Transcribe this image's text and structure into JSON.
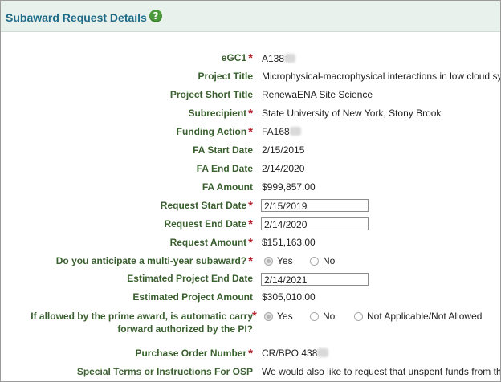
{
  "header": {
    "title": "Subaward Request Details",
    "help_icon": "?"
  },
  "fields": {
    "egc1": {
      "label": "eGC1",
      "value": "A138"
    },
    "project_title": {
      "label": "Project Title",
      "value": "Microphysical-macrophysical interactions in low cloud sy"
    },
    "project_short_title": {
      "label": "Project Short Title",
      "value": "RenewaENA Site Science"
    },
    "subrecipient": {
      "label": "Subrecipient",
      "value": "State University of New York, Stony Brook"
    },
    "funding_action": {
      "label": "Funding Action",
      "value": "FA168"
    },
    "fa_start_date": {
      "label": "FA Start Date",
      "value": "2/15/2015"
    },
    "fa_end_date": {
      "label": "FA End Date",
      "value": "2/14/2020"
    },
    "fa_amount": {
      "label": "FA Amount",
      "value": "$999,857.00"
    },
    "request_start_date": {
      "label": "Request Start Date",
      "value": "2/15/2019"
    },
    "request_end_date": {
      "label": "Request End Date",
      "value": "2/14/2020"
    },
    "request_amount": {
      "label": "Request Amount",
      "value": "$151,163.00"
    },
    "multi_year": {
      "label": "Do you anticipate a multi-year subaward?",
      "options": [
        "Yes",
        "No"
      ],
      "selected": "Yes"
    },
    "estimated_end_date": {
      "label": "Estimated Project End Date",
      "value": "2/14/2021"
    },
    "estimated_amount": {
      "label": "Estimated Project Amount",
      "value": "$305,010.00"
    },
    "carry_forward": {
      "label": "If allowed by the prime award, is automatic carry forward authorized by the PI?",
      "options": [
        "Yes",
        "No",
        "Not Applicable/Not Allowed"
      ],
      "selected": "Yes"
    },
    "purchase_order": {
      "label": "Purchase Order Number",
      "value": "CR/BPO 438"
    },
    "special_terms": {
      "label": "Special Terms or Instructions For OSP",
      "value": "We would also like to request that unspent funds from th"
    }
  },
  "required_marker": "*",
  "colors": {
    "header_bg": "#e8f1ec",
    "title": "#1e6b8a",
    "label": "#3a5f2f",
    "required": "#b3202a",
    "help": "#4d9a3c"
  }
}
